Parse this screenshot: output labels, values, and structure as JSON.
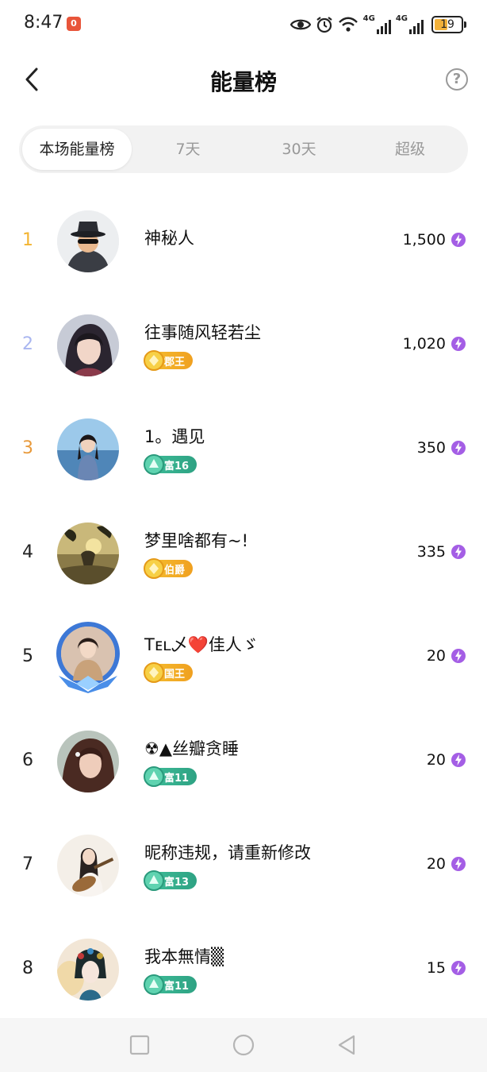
{
  "status_bar": {
    "time": "8:47",
    "notification_badge": "0",
    "network_1": "4G",
    "network_2": "4G",
    "battery": "19"
  },
  "header": {
    "title": "能量榜"
  },
  "tabs": [
    {
      "label": "本场能量榜",
      "active": true
    },
    {
      "label": "7天",
      "active": false
    },
    {
      "label": "30天",
      "active": false
    },
    {
      "label": "超级",
      "active": false
    }
  ],
  "ranking": [
    {
      "rank": "1",
      "name": "神秘人",
      "badge": "",
      "score": "1,500",
      "rank_color": "#f3b430"
    },
    {
      "rank": "2",
      "name": "往事随风轻若尘",
      "badge": "郡王",
      "badge_type": "gold",
      "score": "1,020",
      "rank_color": "#a9b6f0"
    },
    {
      "rank": "3",
      "name": "1。遇见",
      "badge": "富16",
      "badge_type": "green",
      "score": "350",
      "rank_color": "#e89a3c"
    },
    {
      "rank": "4",
      "name": "梦里啥都有~!",
      "badge": "伯爵",
      "badge_type": "gold",
      "score": "335",
      "rank_color": "#222222"
    },
    {
      "rank": "5",
      "name": "Tᴇʟ乄❤️佳人ゞ",
      "badge": "国王",
      "badge_type": "gold",
      "score": "20",
      "rank_color": "#222222"
    },
    {
      "rank": "6",
      "name": "☢▲丝瓣贪睡",
      "badge": "富11",
      "badge_type": "green",
      "score": "20",
      "rank_color": "#222222"
    },
    {
      "rank": "7",
      "name": "昵称违规，请重新修改",
      "badge": "富13",
      "badge_type": "green",
      "score": "20",
      "rank_color": "#222222"
    },
    {
      "rank": "8",
      "name": "我本無情▒",
      "badge": "富11",
      "badge_type": "green",
      "score": "15",
      "rank_color": "#222222"
    }
  ],
  "colors": {
    "energy_bolt": "#a45ee5",
    "gold_badge": "#f2b02a",
    "green_badge": "#35b08f"
  }
}
